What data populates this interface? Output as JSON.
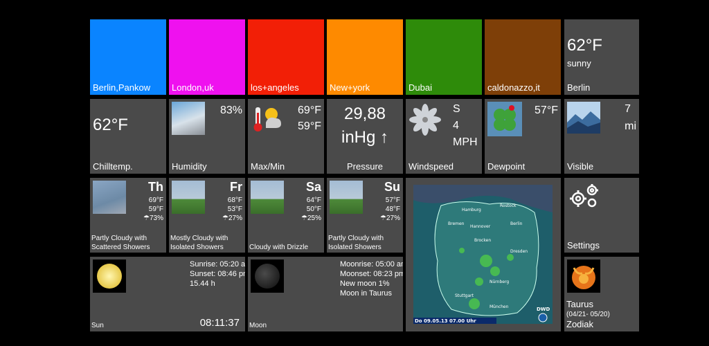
{
  "cities": [
    {
      "name": "Berlin,Pankow",
      "color": "#0a84ff"
    },
    {
      "name": "London,uk",
      "color": "#ef11ef"
    },
    {
      "name": "los+angeles",
      "color": "#f21f06"
    },
    {
      "name": "New+york",
      "color": "#fe8a00"
    },
    {
      "name": "Dubai",
      "color": "#2e8b0a"
    },
    {
      "name": "caldonazzo,it",
      "color": "#7e3f08"
    }
  ],
  "current": {
    "temp": "62°F",
    "condition": "sunny",
    "location": "Berlin"
  },
  "row2": {
    "chill": {
      "value": "62°F",
      "label": "Chilltemp."
    },
    "humidity": {
      "value": "83%",
      "label": "Humidity"
    },
    "maxmin": {
      "max": "69°F",
      "min": "59°F",
      "label": "Max/Min"
    },
    "pressure": {
      "value": "29,88",
      "unit": "inHg ↑",
      "label": "Pressure"
    },
    "wind": {
      "dir": "S",
      "speed": "4",
      "unit": "MPH",
      "label": "Windspeed"
    },
    "dewpoint": {
      "value": "57°F",
      "label": "Dewpoint"
    },
    "visible": {
      "value": "7",
      "unit": "mi",
      "label": "Visible"
    }
  },
  "forecast": [
    {
      "day": "Th",
      "high": "69°F",
      "low": "59°F",
      "rain": "☂73%",
      "desc1": "Partly Cloudy with",
      "desc2": "Scattered Showers"
    },
    {
      "day": "Fr",
      "high": "68°F",
      "low": "53°F",
      "rain": "☂27%",
      "desc1": "Mostly Cloudy with",
      "desc2": "Isolated Showers"
    },
    {
      "day": "Sa",
      "high": "64°F",
      "low": "50°F",
      "rain": "☂25%",
      "desc1": "Cloudy with Drizzle",
      "desc2": ""
    },
    {
      "day": "Su",
      "high": "57°F",
      "low": "48°F",
      "rain": "☂27%",
      "desc1": "Partly Cloudy with",
      "desc2": "Isolated Showers"
    }
  ],
  "sun": {
    "sunrise": "Sunrise: 05:20 am",
    "sunset": "Sunset: 08:46 pm",
    "length": "15.44 h",
    "time": "08:11:37",
    "label": "Sun"
  },
  "moon": {
    "moonrise": "Moonrise: 05:00 am",
    "moonset": "Moonset: 08:23 pm",
    "phase": "New moon 1%",
    "sign": "Moon in Taurus",
    "label": "Moon"
  },
  "map": {
    "caption": "Do 09.05.13 07.00 Uhr",
    "logo": "DWD",
    "cities": [
      "Hamburg",
      "Rostock",
      "Bremen",
      "Hannover",
      "Berlin",
      "Brocken",
      "Dresden",
      "Nürnberg",
      "München",
      "Stuttgart"
    ]
  },
  "settings": {
    "label": "Settings"
  },
  "zodiac": {
    "sign": "Taurus",
    "range": "(04/21- 05/20)",
    "label": "Zodiak"
  }
}
